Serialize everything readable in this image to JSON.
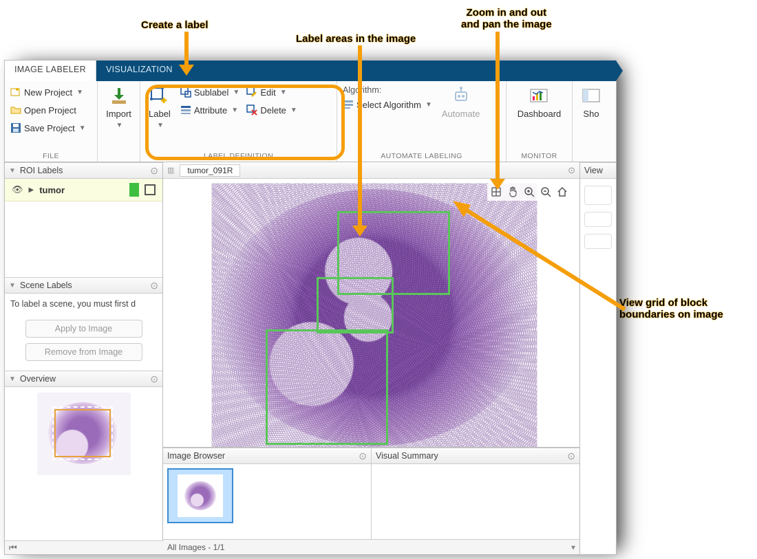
{
  "callouts": {
    "create_label": "Create a label",
    "label_areas": "Label areas in the image",
    "zoom_pan": "Zoom in and out\nand pan the image",
    "view_grid": "View grid of block\nboundaries on image"
  },
  "tabs": {
    "image_labeler": "IMAGE LABELER",
    "visualization": "VISUALIZATION"
  },
  "ribbon": {
    "file": {
      "new_project": "New Project",
      "open_project": "Open Project",
      "save_project": "Save Project",
      "caption": "FILE"
    },
    "import": {
      "label": "Import"
    },
    "labeldef": {
      "label": "Label",
      "sublabel": "Sublabel",
      "attribute": "Attribute",
      "edit": "Edit",
      "delete": "Delete",
      "caption": "LABEL DEFINITION"
    },
    "automate": {
      "algorithm_hdr": "Algorithm:",
      "select_algorithm": "Select Algorithm",
      "automate": "Automate",
      "caption": "AUTOMATE LABELING"
    },
    "monitor": {
      "dashboard": "Dashboard",
      "caption": "MONITOR"
    },
    "show": {
      "label": "Sho"
    }
  },
  "left": {
    "roi_header": "ROI Labels",
    "roi_item": "tumor",
    "scene_header": "Scene Labels",
    "scene_text": "To label a scene, you must first d",
    "apply_btn": "Apply to Image",
    "remove_btn": "Remove from Image",
    "overview_header": "Overview"
  },
  "doc": {
    "tab_name": "tumor_091R"
  },
  "browser": {
    "header": "Image Browser",
    "status": "All Images - 1/1"
  },
  "summary": {
    "header": "Visual Summary"
  },
  "right": {
    "header": "View"
  }
}
